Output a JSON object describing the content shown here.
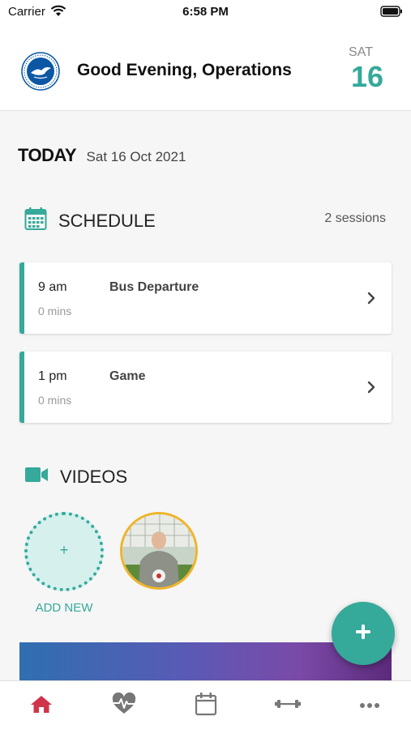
{
  "status_bar": {
    "carrier": "Carrier",
    "time": "6:58 PM",
    "icons": [
      "wifi-icon",
      "battery-icon"
    ]
  },
  "header": {
    "greeting": "Good Evening, Operations",
    "day_name": "SAT",
    "day_number": "16",
    "logo": "club-crest-icon"
  },
  "today": {
    "label": "TODAY",
    "date": "Sat 16 Oct 2021"
  },
  "schedule": {
    "title": "SCHEDULE",
    "count": "2 sessions",
    "icon": "calendar-icon",
    "sessions": [
      {
        "time": "9 am",
        "title": "Bus Departure",
        "duration": "0 mins"
      },
      {
        "time": "1 pm",
        "title": "Game",
        "duration": "0 mins"
      }
    ]
  },
  "videos": {
    "title": "VIDEOS",
    "icon": "video-camera-icon",
    "add_plus": "+",
    "add_label": "ADD NEW"
  },
  "colors": {
    "accent": "#35a99a",
    "thumb_border": "#f0b429",
    "home_active": "#d0344b",
    "tab_inactive": "#777777"
  },
  "tabs": [
    "home-icon",
    "health-heart-icon",
    "calendar-icon",
    "dumbbell-icon",
    "more-icon"
  ]
}
